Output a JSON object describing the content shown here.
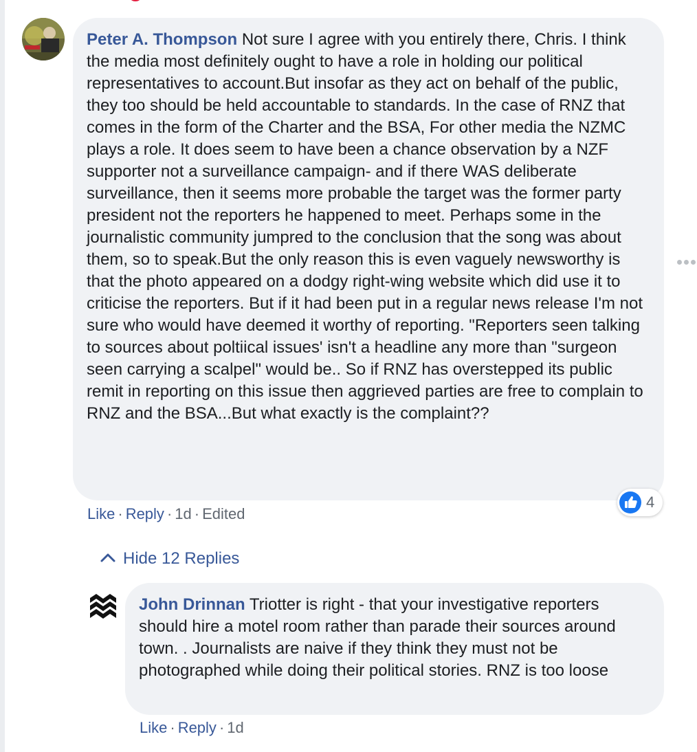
{
  "comments": [
    {
      "author": "Peter A. Thompson",
      "text": "Not sure I agree with you entirely there, Chris. I think the media most definitely ought to have a role in holding our political representatives to account.But insofar as they act on behalf of the public, they too should be held accountable to standards. In the case of RNZ that comes in the form of the Charter and the BSA, For other media the NZMC plays a role. It does seem to have been a chance observation by a NZF supporter not a surveillance campaign- and if there WAS deliberate surveillance, then it seems more probable the target was the former party president not the reporters he happened to meet. Perhaps some in the journalistic community jumpred to the conclusion that the song was about them, so to speak.But the only reason this is even vaguely newsworthy is that the photo appeared on a dodgy right-wing website which did use it to criticise the reporters. But if it had been put in a regular news release I'm not sure who would have deemed it worthy of reporting. \"Reporters seen talking to sources about poltiical issues' isn't a headline any more than \"surgeon seen carrying a scalpel\" would be.. So if RNZ has overstepped its public remit in reporting on this issue then aggrieved parties are free to complain to RNZ and the BSA...But what exactly is the complaint??",
      "reaction_count": "4",
      "reaction_icon": "thumbs-up-icon",
      "actions": {
        "like": "Like",
        "reply": "Reply",
        "time": "1d",
        "edited": "Edited"
      }
    },
    {
      "author": "John Drinnan",
      "text": "Triotter is right - that your investigative reporters should hire a motel room rather than parade their sources around town. . Journalists are naive if they think they must not be photographed while doing their political stories. RNZ is too loose",
      "actions": {
        "like": "Like",
        "reply": "Reply",
        "time": "1d"
      }
    }
  ],
  "replies_toggle": {
    "label": "Hide 12 Replies",
    "icon": "chevron-up-icon"
  },
  "separator": "·",
  "colors": {
    "name_link": "#385898",
    "bubble_bg": "#f0f2f5",
    "meta_text": "#606770",
    "like_blue": "#1877f2"
  }
}
